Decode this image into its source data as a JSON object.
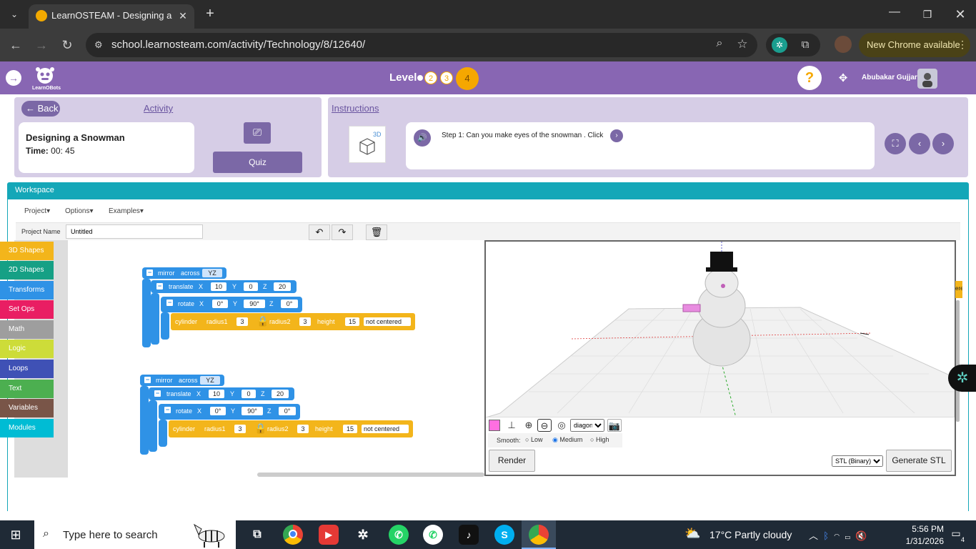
{
  "browser": {
    "tab_title": "LearnOSTEAM - Designing a Sn",
    "url": "school.learnosteam.com/activity/Technology/8/12640/",
    "update_chip": "New Chrome available"
  },
  "header": {
    "logo_text": "LearnOBots",
    "level_label": "Level",
    "levels": [
      "2",
      "3",
      "4"
    ],
    "user_name": "Abubakar Gujjar",
    "help_label": "?"
  },
  "activity": {
    "back_label": "Back",
    "tab_label": "Activity",
    "name": "Designing a Snowman",
    "timer_label": "Time:",
    "timer_value": "00: 45",
    "quiz_label": "Quiz"
  },
  "instructions": {
    "tab_label": "Instructions",
    "icon_label": "3D",
    "step_text": "Step 1: Can you make eyes of the snowman . Click"
  },
  "workspace": {
    "title": "Workspace",
    "menus": [
      "Project",
      "Options",
      "Examples"
    ],
    "project_name_label": "Project Name",
    "project_name_value": "Untitled",
    "categories": [
      {
        "label": "3D Shapes",
        "color": "#f3b51b"
      },
      {
        "label": "2D Shapes",
        "color": "#16a085"
      },
      {
        "label": "Transforms",
        "color": "#2f92e6"
      },
      {
        "label": "Set Ops",
        "color": "#e91e63"
      },
      {
        "label": "Math",
        "color": "#9e9e9e"
      },
      {
        "label": "Logic",
        "color": "#cddc39"
      },
      {
        "label": "Loops",
        "color": "#3f51b5"
      },
      {
        "label": "Text",
        "color": "#4caf50"
      },
      {
        "label": "Variables",
        "color": "#795548"
      },
      {
        "label": "Modules",
        "color": "#00bcd4"
      }
    ]
  },
  "blocks": {
    "mirror": "mirror",
    "across": "across",
    "axis": "YZ",
    "translate": "translate",
    "rotate": "rotate",
    "cylinder": "cylinder",
    "radius1_label": "radius1",
    "radius2_label": "radius2",
    "height_label": "height",
    "x": "X",
    "y": "Y",
    "z": "Z",
    "translate_x": "10",
    "translate_y": "0",
    "translate_z": "20",
    "rotate_x": "0°",
    "rotate_y": "90°",
    "rotate_z": "0°",
    "radius1": "3",
    "radius2": "3",
    "height": "15",
    "centered": "not centered"
  },
  "viewer": {
    "view_mode": "diagonal",
    "smooth_label": "Smooth:",
    "smooth_options": [
      "Low",
      "Medium",
      "High"
    ],
    "smooth_selected": "Medium",
    "render_label": "Render",
    "format": "STL (Binary)",
    "generate_label": "Generate STL",
    "side_tag": "ere"
  },
  "taskbar": {
    "search_placeholder": "Type here to search",
    "weather": "17°C  Partly cloudy",
    "time": "5:56 PM",
    "date": "1/31/2026",
    "notifications": "4"
  }
}
